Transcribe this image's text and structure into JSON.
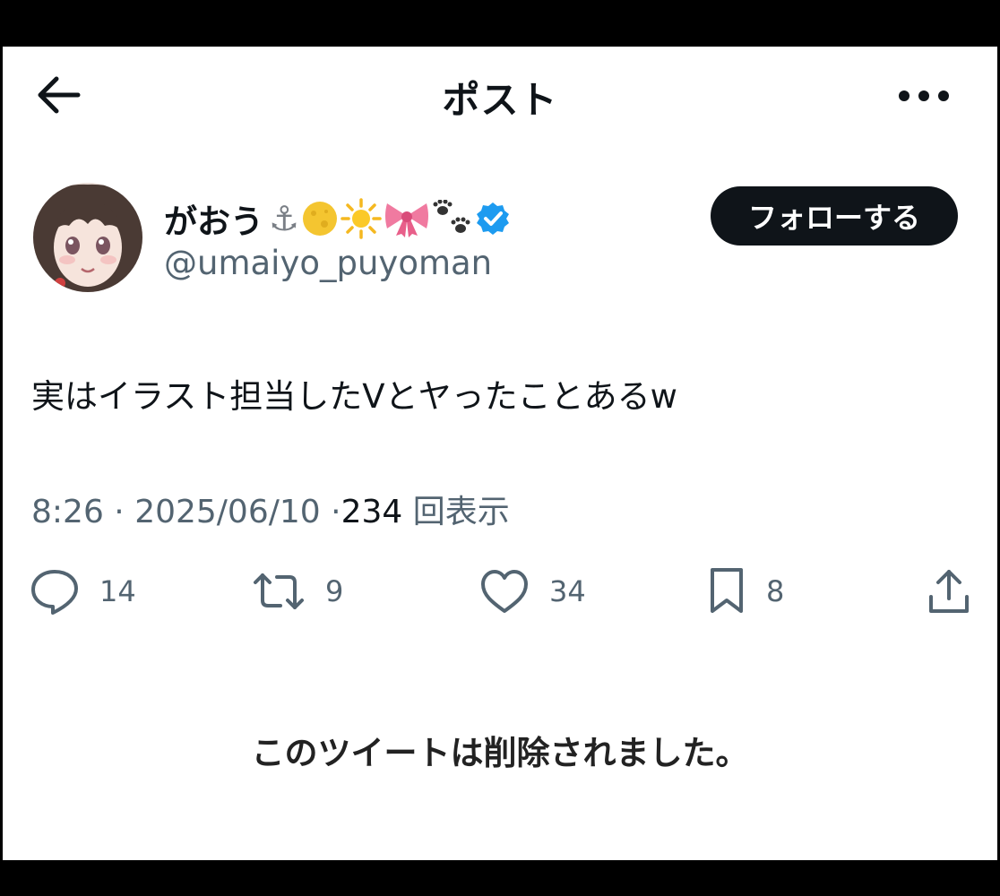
{
  "header": {
    "title": "ポスト",
    "back_icon": "arrow-left-icon",
    "more_icon": "more-horizontal-icon"
  },
  "author": {
    "display_name": "がおう",
    "name_emojis": [
      "⚓",
      "🌕",
      "☀",
      "🎀",
      "🐾"
    ],
    "verified": true,
    "handle": "@umaiyo_puyoman",
    "follow_label": "フォローする"
  },
  "tweet": {
    "text": "実はイラスト担当したVとヤったことあるw",
    "time": "8:26",
    "date": "2025/06/10",
    "views_count": "234",
    "views_label": "回表示"
  },
  "actions": {
    "reply_count": "14",
    "retweet_count": "9",
    "like_count": "34",
    "bookmark_count": "8"
  },
  "notice": "このツイートは削除されました。",
  "colors": {
    "text": "#0f1419",
    "secondary": "#536471",
    "verified": "#1d9bf0",
    "follow_bg": "#0f1419"
  }
}
